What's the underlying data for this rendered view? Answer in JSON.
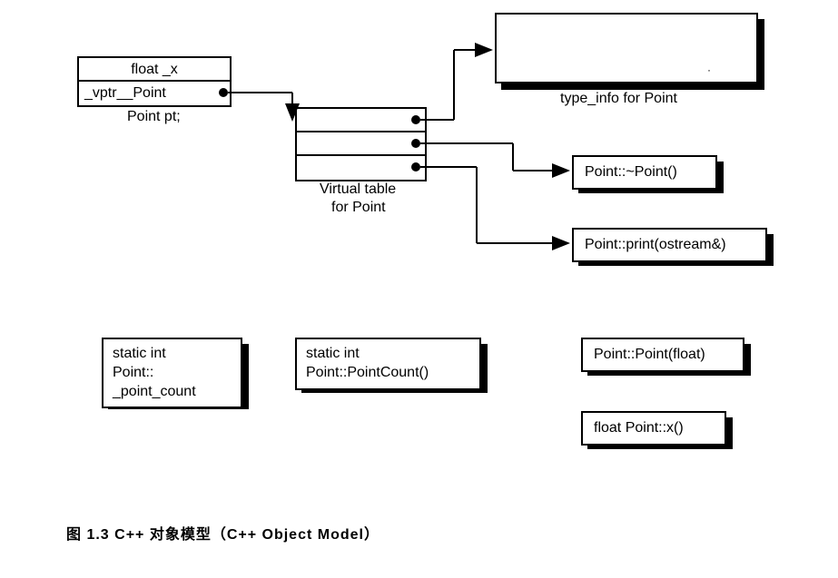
{
  "object_box": {
    "row1": "float _x",
    "row2": "_vptr__Point",
    "caption": "Point pt;"
  },
  "vtable": {
    "caption_line1": "Virtual table",
    "caption_line2": "for Point"
  },
  "typeinfo": {
    "caption": "type_info for Point",
    "dot_char": "·"
  },
  "func_destructor": "Point::~Point()",
  "func_print": "Point::print(ostream&)",
  "static_var": {
    "line1": "static int",
    "line2": "Point::",
    "line3": "_point_count"
  },
  "static_func": {
    "line1": "static int",
    "line2": "Point::PointCount()"
  },
  "func_ctor": "Point::Point(float)",
  "func_x": "float Point::x()",
  "figure_caption": "图 1.3    C++ 对象模型（C++ Object Model）"
}
